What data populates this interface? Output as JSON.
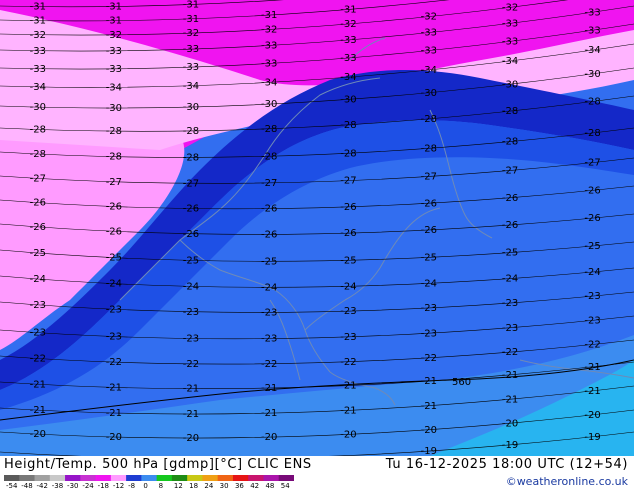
{
  "map": {
    "colors": {
      "magenta": "#f014f0",
      "pink": "#ff9bff",
      "pink_light": "#ffb4ff",
      "dark_blue": "#1428c8",
      "mid_blue": "#1e50e6",
      "blue": "#326ef0",
      "light_blue": "#3c8cf0",
      "cyan": "#28b4f0",
      "outline": "#6e8ab8"
    },
    "height_label": "560",
    "contour_labels_sample": [
      "-31",
      "-32",
      "-33",
      "-34",
      "-30",
      "-28",
      "-27",
      "-26",
      "-25",
      "-24",
      "-23",
      "-22",
      "-21",
      "-20",
      "-19"
    ]
  },
  "footer": {
    "title": "Height/Temp. 500 hPa [gdmp][°C] CLIC ENS",
    "valid": "Tu 16-12-2025 18:00 UTC (12+54)",
    "credit": "©weatheronline.co.uk",
    "scale_ticks": [
      "-54",
      "-48",
      "-42",
      "-38",
      "-30",
      "-24",
      "-18",
      "-12",
      "-8",
      "0",
      "8",
      "12",
      "18",
      "24",
      "30",
      "36",
      "42",
      "48",
      "54"
    ],
    "scale_colors": [
      "#5a5a5a",
      "#787878",
      "#a0a0a0",
      "#c8c8c8",
      "#9614c8",
      "#c832d2",
      "#f014f0",
      "#ff9bff",
      "#1e3cd2",
      "#3c8cf0",
      "#14c81e",
      "#1e8c14",
      "#c8c814",
      "#f0a014",
      "#f06414",
      "#e61414",
      "#c8146e",
      "#aa14aa",
      "#780a78"
    ]
  }
}
